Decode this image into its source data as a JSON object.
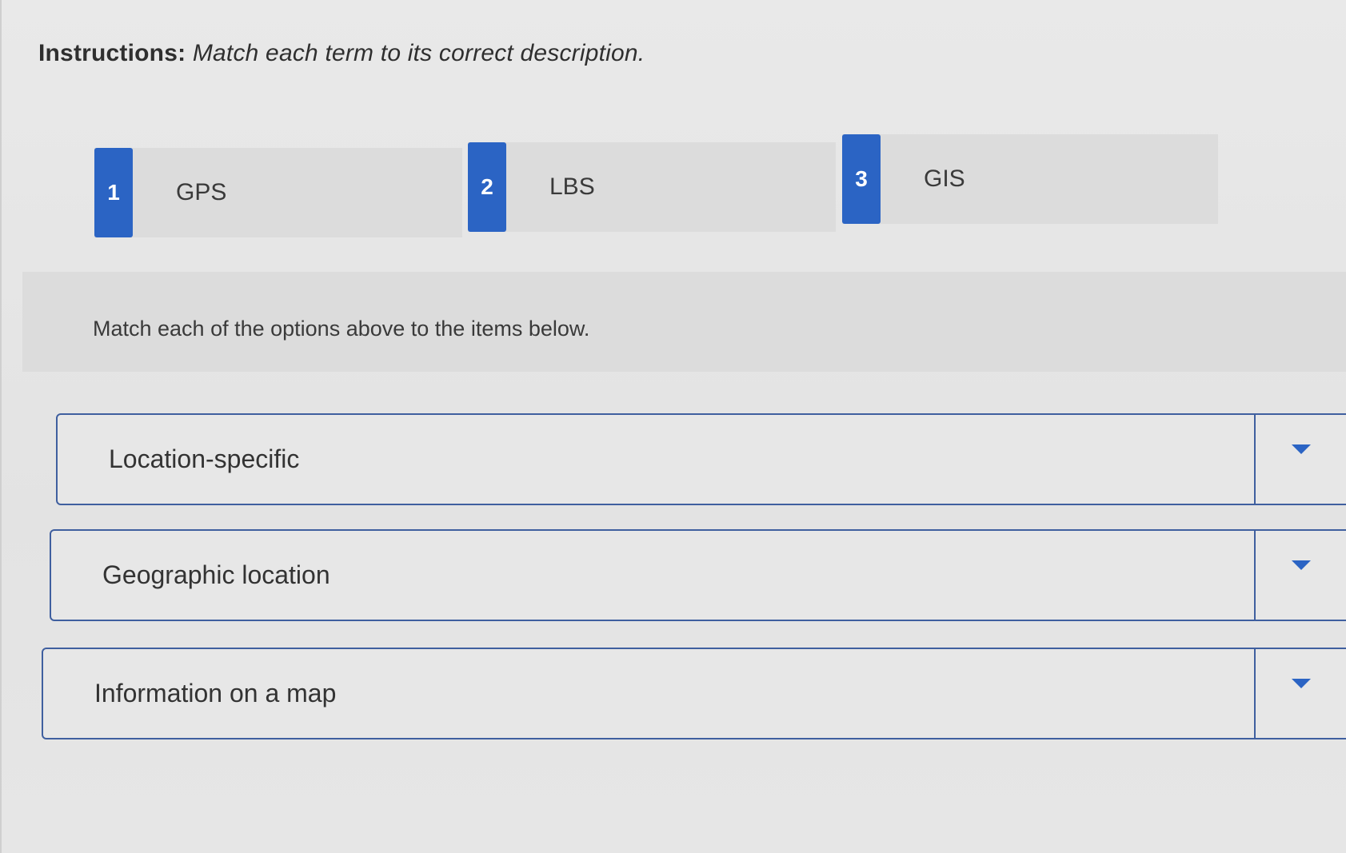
{
  "instructions": {
    "label": "Instructions:",
    "text": "Match each term to its correct description."
  },
  "terms": [
    {
      "number": "1",
      "label": "GPS"
    },
    {
      "number": "2",
      "label": "LBS"
    },
    {
      "number": "3",
      "label": "GIS"
    }
  ],
  "match_prompt": "Match each of the options above to the items below.",
  "items": [
    {
      "label": "Location-specific",
      "selected": ""
    },
    {
      "label": "Geographic location",
      "selected": ""
    },
    {
      "label": "Information on a map",
      "selected": ""
    }
  ],
  "colors": {
    "accent": "#2b64c4",
    "border": "#3f5f9f",
    "card_bg": "#dcdcdc"
  },
  "icons": [
    "chevron-down-icon"
  ]
}
